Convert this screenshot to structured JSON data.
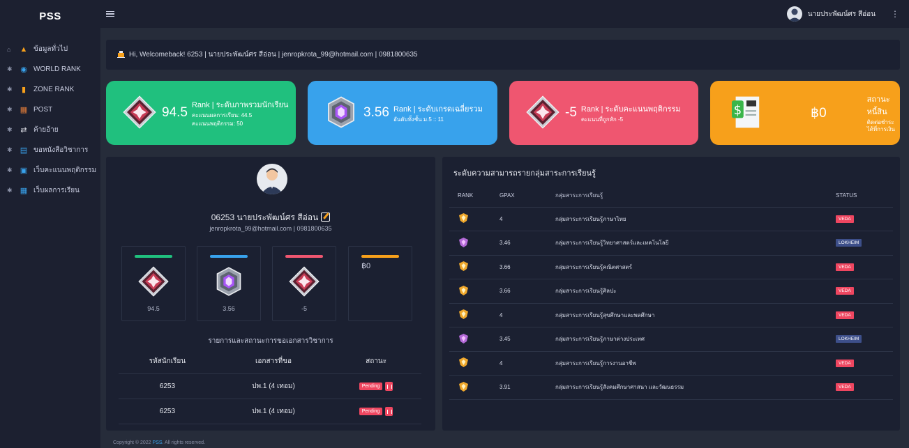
{
  "brand": "PSS",
  "sidebar": {
    "items": [
      {
        "label": "ข้อมูลทั่วไป",
        "icon": "building-icon",
        "bullet": "home-icon"
      },
      {
        "label": "WORLD RANK",
        "icon": "globe-icon",
        "bullet": "pin-icon"
      },
      {
        "label": "ZONE RANK",
        "icon": "bar-chart-icon",
        "bullet": "pin-icon"
      },
      {
        "label": "POST",
        "icon": "board-icon",
        "bullet": "pin-icon"
      },
      {
        "label": "ค้ายอ้าย",
        "icon": "transfer-icon",
        "bullet": "pin-icon"
      },
      {
        "label": "ขอหนังสือวิชาการ",
        "icon": "notes-icon",
        "bullet": "pin-icon"
      },
      {
        "label": "เว็บคะแนนพฤติกรรม",
        "icon": "monitor-icon",
        "bullet": "pin-icon"
      },
      {
        "label": "เว็บผลการเรียน",
        "icon": "grades-icon",
        "bullet": "pin-icon"
      }
    ]
  },
  "topbar": {
    "user_name": "นายประพัฒน์ศร สีอ่อน"
  },
  "welcome": {
    "text": "Hi, Welcomeback! 6253 | นายประพัฒน์ศร สีอ่อน | jenropkrota_99@hotmail.com | 0981800635"
  },
  "cards": [
    {
      "value": "94.5",
      "title": "Rank | ระดับภาพรวมนักเรียน",
      "sub1": "คะแนนผลการเรียน: 44.5",
      "sub2": "คะแนนพฤติกรรม: 50",
      "color": "#20c07e"
    },
    {
      "value": "3.56",
      "title": "Rank | ระดับเกรดเฉลี่ยรวม",
      "sub1": "อันดับทั้งชั้น ม.5 :: 11",
      "sub2": "",
      "color": "#38a2ec"
    },
    {
      "value": "-5",
      "title": "Rank | ระดับคะแนนพฤติกรรม",
      "sub1": "คะแนนที่ถูกหัก -5",
      "sub2": "",
      "color": "#ef5670"
    },
    {
      "value": "฿0",
      "title": "สถานะหนี้สิน",
      "sub1": "ติดต่อชำระได้ที่การเงิน",
      "sub2": "",
      "color": "#f7a01b"
    }
  ],
  "profile": {
    "name": "06253 นายประพัฒน์ศร สีอ่อน",
    "contact": "jenropkrota_99@hotmail.com | 0981800635",
    "minis": [
      {
        "value": "94.5",
        "bar_color": "#20c07e"
      },
      {
        "value": "3.56",
        "bar_color": "#38a2ec"
      },
      {
        "value": "-5",
        "bar_color": "#ef5670"
      },
      {
        "value": "฿0",
        "bar_color": "#f7a01b"
      }
    ],
    "requests_title": "รายการและสถานะการขอเอกสารวิชาการ",
    "req_headers": [
      "รหัสนักเรียน",
      "เอกสารที่ขอ",
      "สถานะ"
    ],
    "requests": [
      {
        "id": "6253",
        "doc": "ปพ.1 (4 เทอม)",
        "status": "Pending"
      },
      {
        "id": "6253",
        "doc": "ปพ.1 (4 เทอม)",
        "status": "Pending"
      }
    ]
  },
  "skills": {
    "title": "ระดับความสามารถรายกลุ่มสาระการเรียนรู้",
    "headers": [
      "RANK",
      "GPAX",
      "กลุ่มสาระการเรียนรู้",
      "STATUS"
    ],
    "rows": [
      {
        "gpax": "4",
        "subject": "กลุ่มสาระการเรียนรู้ภาษาไทย",
        "status": "VEDA"
      },
      {
        "gpax": "3.46",
        "subject": "กลุ่มสาระการเรียนรู้วิทยาศาสตร์และเทคโนโลยี",
        "status": "LOKHEIM"
      },
      {
        "gpax": "3.66",
        "subject": "กลุ่มสาระการเรียนรู้คณิตศาสตร์",
        "status": "VEDA"
      },
      {
        "gpax": "3.66",
        "subject": "กลุ่มสาระการเรียนรู้ศิลปะ",
        "status": "VEDA"
      },
      {
        "gpax": "4",
        "subject": "กลุ่มสาระการเรียนรู้สุขศึกษาและพลศึกษา",
        "status": "VEDA"
      },
      {
        "gpax": "3.45",
        "subject": "กลุ่มสาระการเรียนรู้ภาษาต่างประเทศ",
        "status": "LOKHEIM"
      },
      {
        "gpax": "4",
        "subject": "กลุ่มสาระการเรียนรู้การงานอาชีพ",
        "status": "VEDA"
      },
      {
        "gpax": "3.91",
        "subject": "กลุ่มสาระการเรียนรู้สังคมศึกษาศาสนา และวัฒนธรรม",
        "status": "VEDA"
      }
    ],
    "status_colors": {
      "VEDA": "#ef4660",
      "LOKHEIM": "#3d4f8a"
    }
  },
  "footer": {
    "prefix": "Copyright © 2022 ",
    "link": "PSS",
    "suffix": ". All rights reserved."
  }
}
